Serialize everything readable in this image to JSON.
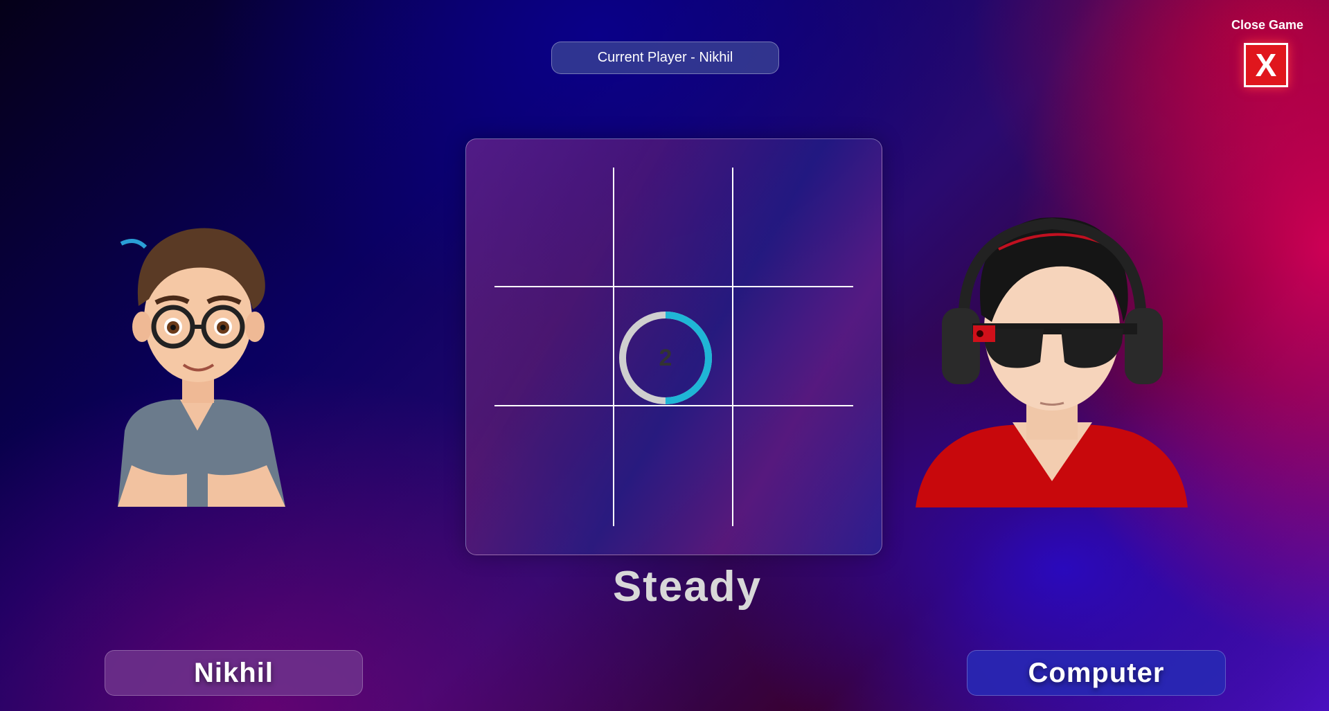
{
  "header": {
    "current_player": "Current Player - Nikhil"
  },
  "close": {
    "label": "Close Game",
    "button": "X"
  },
  "board": {
    "cells": [
      "",
      "",
      "",
      "",
      "",
      "",
      "",
      "",
      ""
    ],
    "countdown": "2",
    "countdown_progress": 0.5
  },
  "status": "Steady",
  "players": {
    "left": {
      "name": "Nikhil",
      "icon": "boy-with-glasses-avatar",
      "color": "#5a2a80"
    },
    "right": {
      "name": "Computer",
      "icon": "man-with-sunglasses-headphones-avatar",
      "color": "#2a28b0"
    }
  },
  "colors": {
    "accent": "#1fb6d6",
    "close": "#e0161d"
  }
}
